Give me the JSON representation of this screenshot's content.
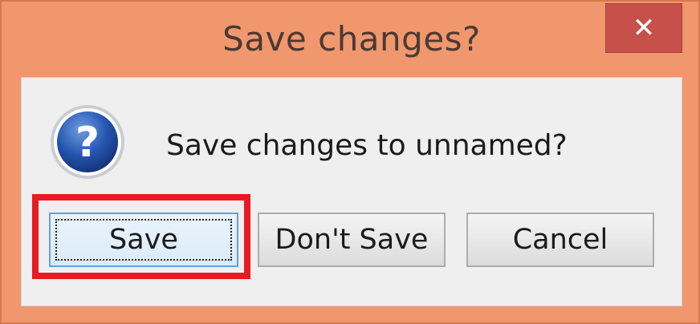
{
  "dialog": {
    "title": "Save changes?",
    "close_label": "✕",
    "message": "Save changes to unnamed?",
    "icon": "question-icon"
  },
  "buttons": {
    "save_label": "Save",
    "dont_save_label": "Don't Save",
    "cancel_label": "Cancel"
  },
  "colors": {
    "frame": "#f0976e",
    "close_button": "#c7504a",
    "highlight": "#e81a22",
    "icon_blue": "#1f4fa8"
  }
}
